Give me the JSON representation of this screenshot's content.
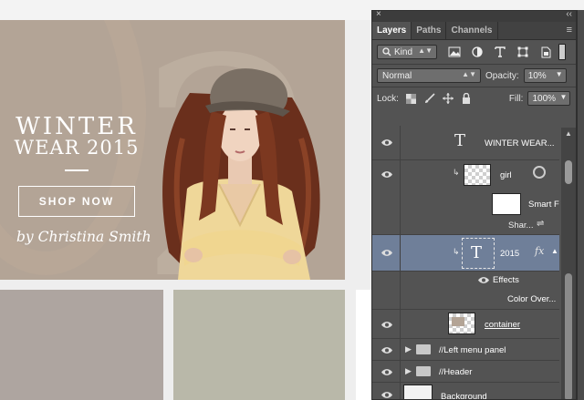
{
  "canvas": {
    "hero": {
      "title_line1": "WINTER",
      "title_line2": "WEAR 2015",
      "button_label": "SHOP NOW",
      "byline": "by Christina Smith",
      "bg_color": "#b3a496"
    }
  },
  "panel": {
    "close_glyph": "×",
    "collapse_glyph": "‹‹",
    "tabs": [
      {
        "label": "Layers",
        "active": true
      },
      {
        "label": "Paths",
        "active": false
      },
      {
        "label": "Channels",
        "active": false
      }
    ],
    "menu_glyph": "≡",
    "filter": {
      "kind_label": "Kind",
      "icons": [
        "image-filter-icon",
        "adjustment-filter-icon",
        "type-filter-icon",
        "shape-filter-icon",
        "smart-object-filter-icon"
      ]
    },
    "blend": {
      "mode": "Normal",
      "opacity_label": "Opacity:",
      "opacity_value": "10%"
    },
    "lock": {
      "label": "Lock:",
      "fill_label": "Fill:",
      "fill_value": "100%"
    },
    "layers": {
      "winter": "WINTER WEAR...",
      "girl": "girl",
      "smart_filters": "Smart F",
      "sharpen": "Shar...",
      "year": "2015",
      "fx": "fx",
      "effects": "Effects",
      "color_overlay": "Color Over...",
      "container": "container",
      "left_menu": "//Left menu panel",
      "header": "//Header",
      "background": "Background"
    },
    "selected_layer": "2015",
    "selection_color": "#6f7f99"
  }
}
